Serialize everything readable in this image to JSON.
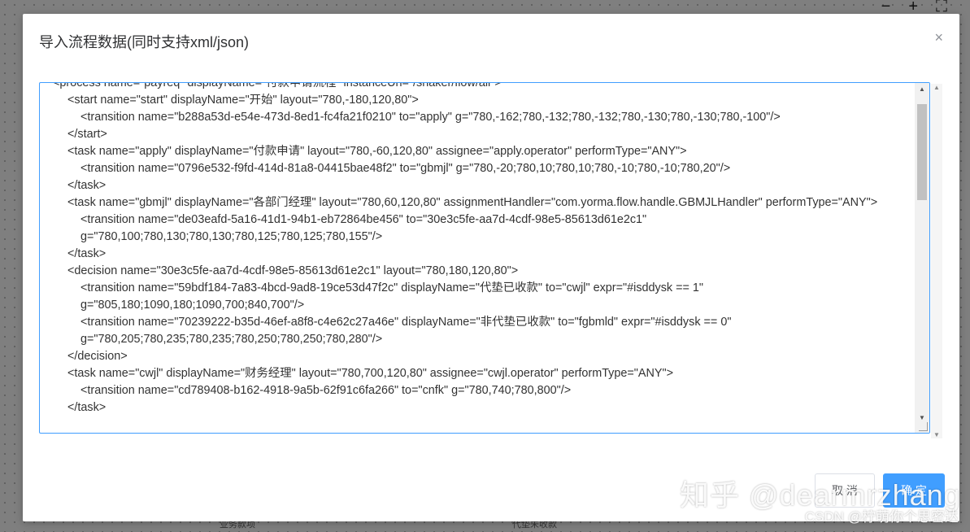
{
  "dialog": {
    "title": "导入流程数据(同时支持xml/json)",
    "close_glyph": "×"
  },
  "editor": {
    "lines": [
      {
        "indent": 0,
        "text": "<process name=\"payreq\" displayName=\"付款申请流程\" instanceUrl=\"/snaker/flow/all\">"
      },
      {
        "indent": 1,
        "text": "<start name=\"start\" displayName=\"开始\" layout=\"780,-180,120,80\">"
      },
      {
        "indent": 2,
        "text": "<transition name=\"b288a53d-e54e-473d-8ed1-fc4fa21f0210\" to=\"apply\" g=\"780,-162;780,-132;780,-132;780,-130;780,-130;780,-100\"/>"
      },
      {
        "indent": 1,
        "text": "</start>"
      },
      {
        "indent": 1,
        "text": "<task name=\"apply\" displayName=\"付款申请\" layout=\"780,-60,120,80\" assignee=\"apply.operator\" performType=\"ANY\">"
      },
      {
        "indent": 2,
        "text": "<transition name=\"0796e532-f9fd-414d-81a8-04415bae48f2\" to=\"gbmjl\" g=\"780,-20;780,10;780,10;780,-10;780,-10;780,20\"/>"
      },
      {
        "indent": 1,
        "text": "</task>"
      },
      {
        "indent": 1,
        "text": "<task name=\"gbmjl\" displayName=\"各部门经理\" layout=\"780,60,120,80\" assignmentHandler=\"com.yorma.flow.handle.GBMJLHandler\" performType=\"ANY\">"
      },
      {
        "indent": 2,
        "text": "<transition name=\"de03eafd-5a16-41d1-94b1-eb72864be456\" to=\"30e3c5fe-aa7d-4cdf-98e5-85613d61e2c1\" g=\"780,100;780,130;780,130;780,125;780,125;780,155\"/>"
      },
      {
        "indent": 1,
        "text": "</task>"
      },
      {
        "indent": 1,
        "text": "<decision name=\"30e3c5fe-aa7d-4cdf-98e5-85613d61e2c1\" layout=\"780,180,120,80\">"
      },
      {
        "indent": 2,
        "text": "<transition name=\"59bdf184-7a83-4bcd-9ad8-19ce53d47f2c\" displayName=\"代垫已收款\" to=\"cwjl\" expr=\"#isddysk == 1\" g=\"805,180;1090,180;1090,700;840,700\"/>"
      },
      {
        "indent": 2,
        "text": "<transition name=\"70239222-b35d-46ef-a8f8-c4e62c27a46e\" displayName=\"非代垫已收款\" to=\"fgbmld\" expr=\"#isddysk == 0\" g=\"780,205;780,235;780,235;780,250;780,250;780,280\"/>"
      },
      {
        "indent": 1,
        "text": "</decision>"
      },
      {
        "indent": 1,
        "text": "<task name=\"cwjl\" displayName=\"财务经理\" layout=\"780,700,120,80\" assignee=\"cwjl.operator\" performType=\"ANY\">"
      },
      {
        "indent": 2,
        "text": "<transition name=\"cd789408-b162-4918-9a5b-62f91c6fa266\" to=\"cnfk\" g=\"780,740;780,800\"/>"
      },
      {
        "indent": 1,
        "text": "</task>"
      }
    ]
  },
  "footer": {
    "cancel_label": "取 消",
    "ok_label": "确 定"
  },
  "background_canvas": {
    "toolbar": [
      "−",
      "+",
      "⛶"
    ],
    "edge_labels": [
      "业务款项",
      "代垫未收款"
    ]
  },
  "watermarks": {
    "zhihu": "知乎 @dearmrzhang",
    "csdn": "CSDN @柠萌你个思密达"
  },
  "colors": {
    "primary": "#409eff",
    "title_text": "#303133"
  }
}
